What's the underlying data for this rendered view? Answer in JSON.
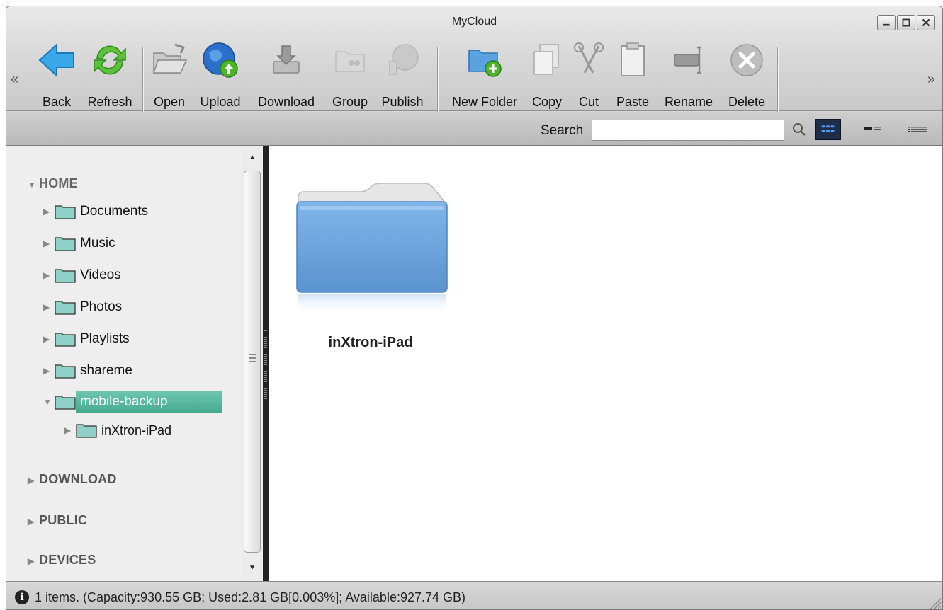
{
  "window": {
    "title": "MyCloud"
  },
  "toolbar": {
    "scroll_left": "«",
    "scroll_right": "»",
    "buttons": {
      "back": "Back",
      "refresh": "Refresh",
      "open": "Open",
      "upload": "Upload",
      "download": "Download",
      "group": "Group",
      "publish": "Publish",
      "new_folder": "New Folder",
      "copy": "Copy",
      "cut": "Cut",
      "paste": "Paste",
      "rename": "Rename",
      "delete": "Delete"
    }
  },
  "search": {
    "label": "Search",
    "value": ""
  },
  "tree": {
    "home": "HOME",
    "items": [
      "Documents",
      "Music",
      "Videos",
      "Photos",
      "Playlists",
      "shareme",
      "mobile-backup"
    ],
    "selected": "mobile-backup",
    "child": "inXtron-iPad",
    "sections": [
      "DOWNLOAD",
      "PUBLIC",
      "DEVICES"
    ]
  },
  "content": {
    "folder_name": "inXtron-iPad"
  },
  "status": {
    "text": "1 items. (Capacity:930.55 GB; Used:2.81 GB[0.003%]; Available:927.74 GB)"
  },
  "colors": {
    "selection": "#45a88f",
    "folder": "#6aa3d8",
    "tree_folder": "#8fd1c8",
    "view_active": "#1e2d48"
  }
}
